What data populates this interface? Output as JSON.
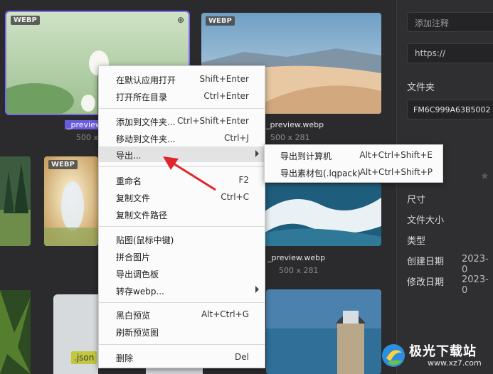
{
  "thumbs": {
    "t1": {
      "badge": "WEBP",
      "caption": "_preview",
      "dims": "500 x"
    },
    "t2": {
      "badge": "WEBP",
      "caption": "_preview.webp",
      "dims": "500 x 281"
    },
    "t3": {
      "badge": "WEBP"
    },
    "t4": {
      "caption": "_preview.webp",
      "dims": "500 x 281"
    },
    "t5": {
      "label": ".json"
    }
  },
  "right_panel": {
    "note_placeholder": "添加注释",
    "url_placeholder": "https://",
    "folder_label": "文件夹",
    "folder_value": "FM6C999A63B5002",
    "size_label": "尺寸",
    "filesize_label": "文件大小",
    "type_label": "类型",
    "created_label": "创建日期",
    "created_value": "2023-0",
    "modified_label": "修改日期",
    "modified_value": "2023-0"
  },
  "context_menu": {
    "items": [
      {
        "label": "在默认应用打开",
        "shortcut": "Shift+Enter"
      },
      {
        "label": "打开所在目录",
        "shortcut": "Ctrl+Enter"
      },
      {
        "label": "添加到文件夹...",
        "shortcut": "Ctrl+Shift+Enter"
      },
      {
        "label": "移动到文件夹...",
        "shortcut": "Ctrl+J"
      },
      {
        "label": "导出...",
        "shortcut": ""
      },
      {
        "label": "重命名",
        "shortcut": "F2"
      },
      {
        "label": "复制文件",
        "shortcut": "Ctrl+C"
      },
      {
        "label": "复制文件路径",
        "shortcut": ""
      },
      {
        "label": "贴图(鼠标中键)",
        "shortcut": ""
      },
      {
        "label": "拼合图片",
        "shortcut": ""
      },
      {
        "label": "导出调色板",
        "shortcut": ""
      },
      {
        "label": "转存webp...",
        "shortcut": ""
      },
      {
        "label": "黑白预览",
        "shortcut": "Alt+Ctrl+G"
      },
      {
        "label": "刷新预览图",
        "shortcut": ""
      },
      {
        "label": "删除",
        "shortcut": "Del"
      }
    ]
  },
  "export_submenu": {
    "items": [
      {
        "label": "导出到计算机",
        "shortcut": "Alt+Ctrl+Shift+E"
      },
      {
        "label": "导出素材包(.lqpack)",
        "shortcut": "Alt+Ctrl+Shift+P"
      }
    ]
  },
  "watermark": {
    "text": "极光下载站",
    "url": "www.xz7.com"
  },
  "colors": {
    "accent": "#7b6cf0",
    "arrow": "#e0262c"
  }
}
